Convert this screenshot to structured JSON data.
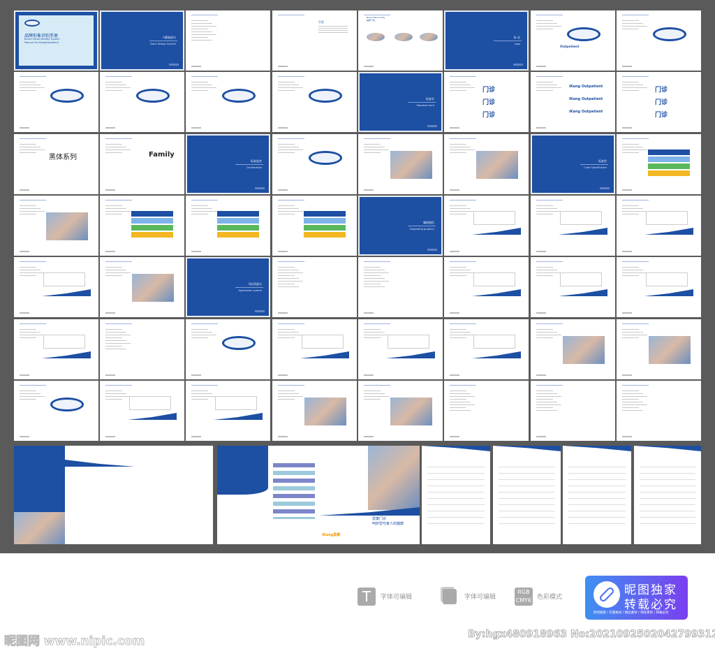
{
  "colors": {
    "brand_blue": "#1d4fa3",
    "board": "#5a5a5a",
    "badge_start": "#3f8ff0",
    "badge_end": "#7b3ff0"
  },
  "cover": {
    "title_cn": "品牌形象识别手册",
    "title_en1": "Brand Visual Identity System",
    "title_en2": "Manual For iKangOutpatient"
  },
  "grid": [
    [
      "cover",
      {
        "k": "section",
        "t": "A基础部分",
        "e": "Basic Design System"
      },
      "text",
      {
        "k": "intro",
        "t": "引言"
      },
      {
        "k": "personality",
        "t": "Brand Personality",
        "c": "品牌个性"
      },
      {
        "k": "section",
        "t": "标 志",
        "e": "Logo"
      },
      {
        "k": "logo",
        "t": "Outpatient"
      },
      "logo"
    ],
    [
      "logo",
      "logo",
      "logo",
      "logo",
      {
        "k": "section",
        "t": "标准字",
        "e": "Standard word"
      },
      {
        "k": "word",
        "t": "门诊"
      },
      {
        "k": "word",
        "t": "iKang Outpatient"
      },
      {
        "k": "word",
        "t": "门诊"
      }
    ],
    [
      {
        "k": "font",
        "t": "黑体系列"
      },
      {
        "k": "font",
        "t": "Family"
      },
      {
        "k": "section",
        "t": "标准组合",
        "e": "Combination"
      },
      "logo",
      "photo",
      "photo",
      {
        "k": "section",
        "t": "标准色",
        "e": "Color Specification"
      },
      "color"
    ],
    [
      "photo",
      "color",
      "color",
      "color",
      {
        "k": "section",
        "t": "辅助图形",
        "e": "Supporting graphics"
      },
      "wave",
      "wave",
      "wave"
    ],
    [
      "wave",
      "photo",
      {
        "k": "section",
        "t": "B应用部分",
        "e": "Application system"
      },
      "text",
      "text",
      "wave",
      "wave",
      "wave"
    ],
    [
      "wave",
      "text",
      "logo",
      "wave",
      "wave",
      "wave",
      "photo",
      "photo"
    ],
    [
      "logo",
      "wave",
      "wave",
      "photo",
      "photo",
      "text",
      "text",
      "text"
    ]
  ],
  "brochure": {
    "brand": "iKang爱康",
    "title1": "爱康门诊",
    "title2": "呵护您与家人的健康"
  },
  "features": [
    {
      "icon": "T",
      "label": "字体可编辑"
    },
    {
      "icon": "",
      "label": "字体可编辑"
    },
    {
      "icon": "RGB CMYK",
      "label": "色彩模式"
    }
  ],
  "badge": {
    "line1": "昵图独家",
    "line2": "转载必究",
    "tagline": "原创独家 / 矢量格式 / 精品素材 / 持续更新 / 转载必究"
  },
  "watermark": {
    "site": "昵图网 www.nipic.com",
    "author": "By:hgx480918963 No:20210925020427993120"
  }
}
